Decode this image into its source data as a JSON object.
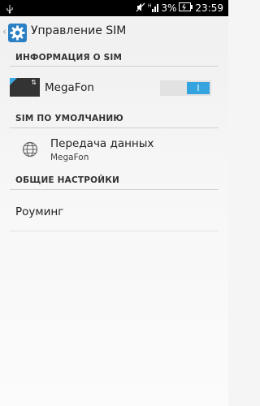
{
  "status_bar": {
    "battery_percent": "3%",
    "time": "23:59"
  },
  "action_bar": {
    "title": "Управление SIM"
  },
  "sections": {
    "sim_info": {
      "header": "ИНФОРМАЦИЯ О SIM",
      "sim_name": "MegaFon",
      "toggle_text": "I",
      "toggle_on": true
    },
    "sim_default": {
      "header": "SIM ПО УМОЛЧАНИЮ",
      "data_title": "Передача данных",
      "data_sub": "MegaFon"
    },
    "general": {
      "header": "ОБЩИЕ НАСТРОЙКИ",
      "roaming_label": "Роуминг"
    }
  },
  "colors": {
    "accent": "#35a3de",
    "app_icon": "#2b7fc3",
    "status_bar_bg": "#000000"
  }
}
